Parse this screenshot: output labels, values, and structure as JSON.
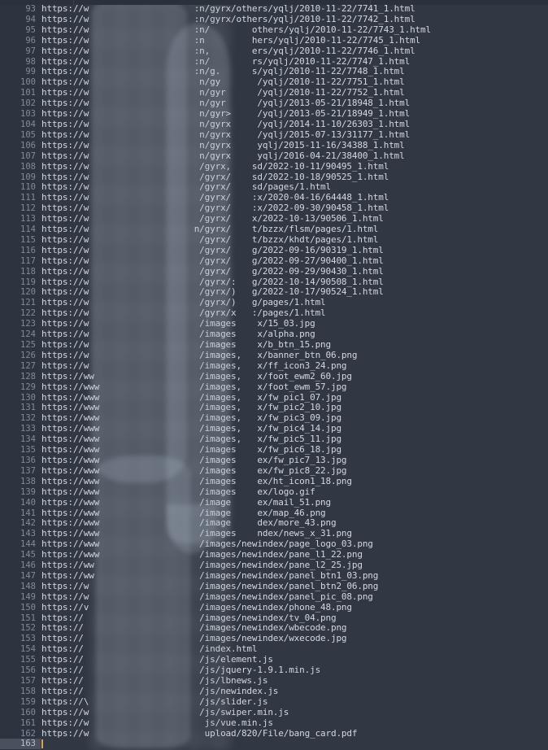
{
  "editor": {
    "theme_background": "#323843",
    "gutter_background": "#2e343f",
    "text_color": "#d3d8e0",
    "line_number_color": "#828b99",
    "caret_color": "#e0a04a",
    "active_line_gutter_color": "#4a515e",
    "first_line_number": 93,
    "active_line_number": 163,
    "redaction": {
      "label": "blurred-overlay",
      "covers": "url-domain-segment"
    },
    "lines": [
      {
        "n": "93",
        "text": "https://w                    :n/gyrx/others/yqlj/2010-11-22/7741_1.html"
      },
      {
        "n": "94",
        "text": "https://w                    :n/gyrx/others/yqlj/2010-11-22/7742_1.html"
      },
      {
        "n": "95",
        "text": "https://w                    :n/        others/yqlj/2010-11-22/7743_1.html"
      },
      {
        "n": "96",
        "text": "https://w                    :n         hers/yqlj/2010-11-22/7745_1.html"
      },
      {
        "n": "97",
        "text": "https://w                    :n,        ers/yqlj/2010-11-22/7746_1.html"
      },
      {
        "n": "98",
        "text": "https://w                    :n/        rs/yqlj/2010-11-22/7747_1.html"
      },
      {
        "n": "99",
        "text": "https://w                    :n/g.      s/yqlj/2010-11-22/7748_1.html"
      },
      {
        "n": "100",
        "text": "https://w                     n/gy       /yqlj/2010-11-22/7751_1.html"
      },
      {
        "n": "101",
        "text": "https://w                     n/gyr      /yqlj/2010-11-22/7752_1.html"
      },
      {
        "n": "102",
        "text": "https://w                     n/gyr      /yqlj/2013-05-21/18948_1.html"
      },
      {
        "n": "103",
        "text": "https://w                     n/gyr>     /yqlj/2013-05-21/18949_1.html"
      },
      {
        "n": "104",
        "text": "https://w                     n/gyrx     /yqlj/2014-11-10/26303_1.html"
      },
      {
        "n": "105",
        "text": "https://w                     n/gyrx     /yqlj/2015-07-13/31177_1.html"
      },
      {
        "n": "106",
        "text": "https://w                     n/gyrx     yqlj/2015-11-16/34388_1.html"
      },
      {
        "n": "107",
        "text": "https://w                     n/gyrx     yqlj/2016-04-21/38400_1.html"
      },
      {
        "n": "108",
        "text": "https://w                     /gyrx,    sd/2022-10-11/90495_1.html"
      },
      {
        "n": "109",
        "text": "https://w                     /gyrx/    sd/2022-10-18/90525_1.html"
      },
      {
        "n": "110",
        "text": "https://w                     /gyrx/    sd/pages/1.html"
      },
      {
        "n": "111",
        "text": "https://w                     /gyrx/    :x/2020-04-16/64448_1.html"
      },
      {
        "n": "112",
        "text": "https://w                     /gyrx/    :x/2022-09-30/90458_1.html"
      },
      {
        "n": "113",
        "text": "https://w                     /gyrx/    x/2022-10-13/90506_1.html"
      },
      {
        "n": "114",
        "text": "https://w                    n/gyrx/    t/bzzx/flsm/pages/1.html"
      },
      {
        "n": "115",
        "text": "https://w                     /gyrx/    t/bzzx/khdt/pages/1.html"
      },
      {
        "n": "116",
        "text": "https://w                     /gyrx/    g/2022-09-16/90319_1.html"
      },
      {
        "n": "117",
        "text": "https://w                     /gyrx/    g/2022-09-27/90400_1.html"
      },
      {
        "n": "118",
        "text": "https://w                     /gyrx/    g/2022-09-29/90430_1.html"
      },
      {
        "n": "119",
        "text": "https://w                     /gyrx/:   g/2022-10-14/90508_1.html"
      },
      {
        "n": "120",
        "text": "https://w                     /gyrx/)   g/2022-10-17/90524_1.html"
      },
      {
        "n": "121",
        "text": "https://w                     /gyrx/)   g/pages/1.html"
      },
      {
        "n": "122",
        "text": "https://w                     /gyrx/x   :/pages/1.html"
      },
      {
        "n": "123",
        "text": "https://w                     /images    x/15_03.jpg"
      },
      {
        "n": "124",
        "text": "https://w                     /images    x/alpha.png"
      },
      {
        "n": "125",
        "text": "https://w                     /images    x/b_btn_15.png"
      },
      {
        "n": "126",
        "text": "https://w                     /images,   x/banner_btn_06.png"
      },
      {
        "n": "127",
        "text": "https://w                     /images,   x/ff_icon3_24.png"
      },
      {
        "n": "128",
        "text": "https://ww                    /images,   x/foot_ewm2_60.jpg"
      },
      {
        "n": "129",
        "text": "https://www                   /images,   x/foot_ewm_57.jpg"
      },
      {
        "n": "130",
        "text": "https://www                   /images,   x/fw_pic1_07.jpg"
      },
      {
        "n": "131",
        "text": "https://www                   /images,   x/fw_pic2_10.jpg"
      },
      {
        "n": "132",
        "text": "https://www                   /images,   x/fw_pic3_09.jpg"
      },
      {
        "n": "133",
        "text": "https://www                   /images,   x/fw_pic4_14.jpg"
      },
      {
        "n": "134",
        "text": "https://www                   /images,   x/fw_pic5_11.jpg"
      },
      {
        "n": "135",
        "text": "https://www                   /images    x/fw_pic6_18.jpg"
      },
      {
        "n": "136",
        "text": "https://www                   /images    ex/fw_pic7_13.jpg"
      },
      {
        "n": "137",
        "text": "https://www                   /images    ex/fw_pic8_22.jpg"
      },
      {
        "n": "138",
        "text": "https://www                   /images    ex/ht_icon1_18.png"
      },
      {
        "n": "139",
        "text": "https://www                   /images    ex/logo.gif"
      },
      {
        "n": "140",
        "text": "https://www                   /image     ex/mail_51.png"
      },
      {
        "n": "141",
        "text": "https://www                   /image     ex/map_46.png"
      },
      {
        "n": "142",
        "text": "https://www                   /image     dex/more_43.png"
      },
      {
        "n": "143",
        "text": "https://www                   /images    ndex/news_x_31.png"
      },
      {
        "n": "144",
        "text": "https://www                   /images/newindex/page_logo_03.png"
      },
      {
        "n": "145",
        "text": "https://www                   /images/newindex/pane_l1_22.png"
      },
      {
        "n": "146",
        "text": "https://ww                    /images/newindex/pane_l2_25.jpg"
      },
      {
        "n": "147",
        "text": "https://ww                    /images/newindex/panel_btn1_03.png"
      },
      {
        "n": "148",
        "text": "https://w                     /images/newindex/panel_btn2_06.png"
      },
      {
        "n": "149",
        "text": "https://w                     /images/newindex/panel_pic_08.png"
      },
      {
        "n": "150",
        "text": "https://v                     /images/newindex/phone_48.png"
      },
      {
        "n": "151",
        "text": "https://                      /images/newindex/tv_04.png"
      },
      {
        "n": "152",
        "text": "https://                      /images/newindex/wbecode.png"
      },
      {
        "n": "153",
        "text": "https://                      /images/newindex/wxecode.jpg"
      },
      {
        "n": "154",
        "text": "https://                      /index.html"
      },
      {
        "n": "155",
        "text": "https://                      /js/element.js"
      },
      {
        "n": "156",
        "text": "https://                      /js/jquery-1.9.1.min.js"
      },
      {
        "n": "157",
        "text": "https://                      /js/lbnews.js"
      },
      {
        "n": "158",
        "text": "https://                      /js/newindex.js"
      },
      {
        "n": "159",
        "text": "https://\\                     /js/slider.js"
      },
      {
        "n": "160",
        "text": "https://w                     /js/swiper.min.js"
      },
      {
        "n": "161",
        "text": "https://w                      js/vue.min.js"
      },
      {
        "n": "162",
        "text": "https://w                      upload/820/File/bang_card.pdf"
      },
      {
        "n": "163",
        "text": ""
      }
    ]
  }
}
